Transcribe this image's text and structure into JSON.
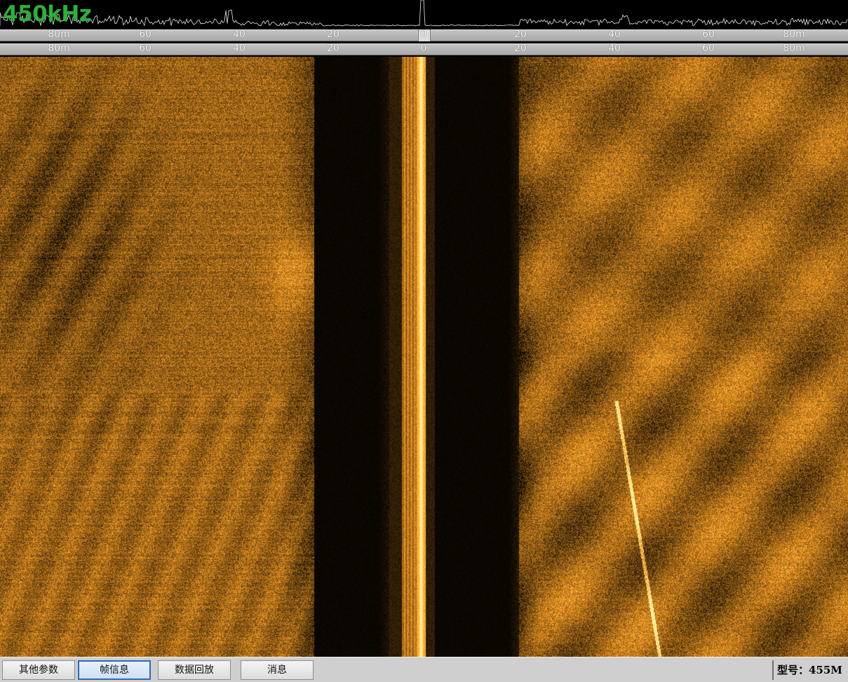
{
  "frequency_label": "450kHz",
  "ruler_top": {
    "ticks": [
      "80m",
      "60",
      "40",
      "20",
      "0",
      "20",
      "40",
      "60",
      "80m"
    ]
  },
  "ruler_bottom": {
    "ticks": [
      "80m",
      "60",
      "40",
      "20",
      "0",
      "20",
      "40",
      "60",
      "80m"
    ]
  },
  "range": {
    "max_m": 80,
    "unit": "m"
  },
  "tabs": [
    {
      "label": "其他参数",
      "active": false
    },
    {
      "label": "帧信息",
      "active": true
    },
    {
      "label": "数据回放",
      "active": false
    },
    {
      "label": "消息",
      "active": false
    }
  ],
  "model_label": "型号：455M",
  "colors": {
    "sonar_palette": "#d9a21f",
    "frequency_text": "#2fae3a",
    "active_tab_border": "#2f6ab8"
  }
}
